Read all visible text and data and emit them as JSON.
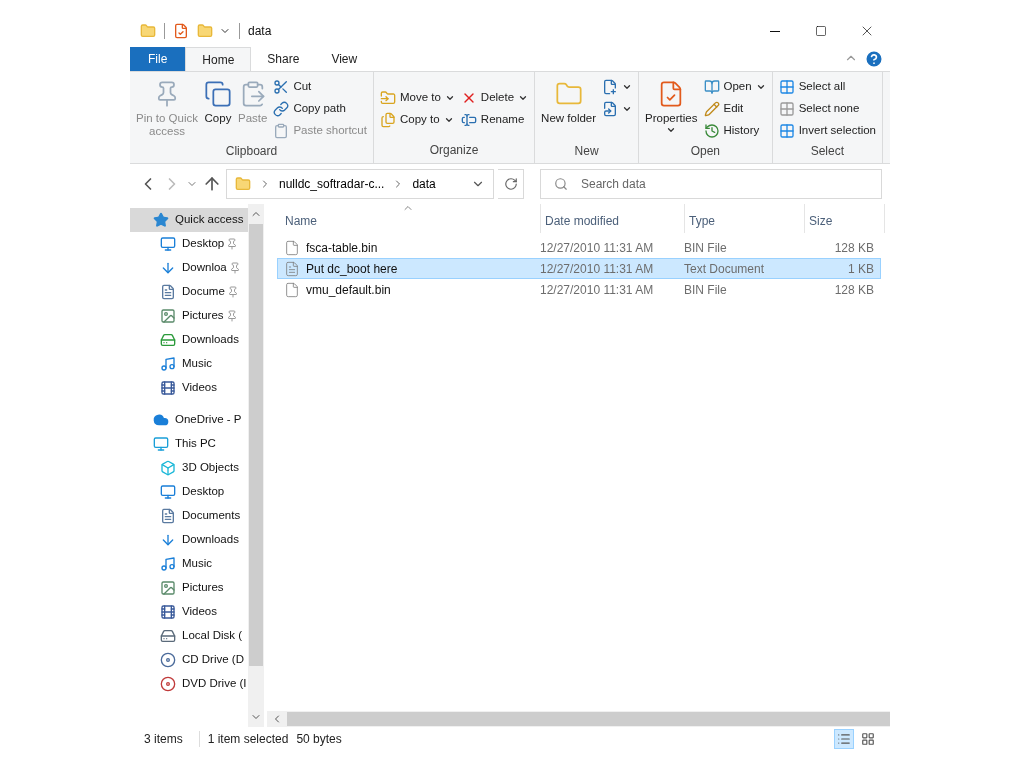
{
  "window": {
    "title": "data"
  },
  "tabs": [
    {
      "label": "File",
      "kind": "file",
      "selected": false
    },
    {
      "label": "Home",
      "kind": "tab",
      "selected": true
    },
    {
      "label": "Share",
      "kind": "tab",
      "selected": false
    },
    {
      "label": "View",
      "kind": "tab",
      "selected": false
    }
  ],
  "ribbon": [
    {
      "name": "Clipboard",
      "items": [
        {
          "kind": "pin",
          "label": "Pin to Quick access",
          "disabled": true,
          "dropdown": false
        },
        {
          "kind": "copy",
          "label": "Copy",
          "disabled": false,
          "dropdown": false
        },
        {
          "kind": "paste",
          "label": "Paste",
          "disabled": true,
          "dropdown": false
        },
        {
          "kind": "cut",
          "label": "Cut",
          "disabled": false,
          "dropdown": false
        },
        {
          "kind": "copypath",
          "label": "Copy path",
          "disabled": false,
          "dropdown": false
        },
        {
          "kind": "shortcut",
          "label": "Paste shortcut",
          "disabled": true,
          "dropdown": false
        }
      ]
    },
    {
      "name": "Organize",
      "items": [
        {
          "kind": "move",
          "label": "Move to",
          "disabled": false,
          "dropdown": true
        },
        {
          "kind": "copyto",
          "label": "Copy to",
          "disabled": false,
          "dropdown": true
        },
        {
          "kind": "delete",
          "label": "Delete",
          "disabled": false,
          "dropdown": true
        },
        {
          "kind": "rename",
          "label": "Rename",
          "disabled": false,
          "dropdown": false
        }
      ]
    },
    {
      "name": "New",
      "items": [
        {
          "kind": "folder",
          "label": "New folder",
          "disabled": false,
          "dropdown": false
        },
        {
          "kind": "newitem",
          "disabled": false,
          "dropdown": true
        },
        {
          "kind": "easyaccess",
          "disabled": false,
          "dropdown": true
        }
      ]
    },
    {
      "name": "Open",
      "items": [
        {
          "kind": "properties",
          "label": "Properties",
          "disabled": false,
          "dropdown": true
        },
        {
          "kind": "open",
          "label": "Open",
          "disabled": false,
          "dropdown": true
        },
        {
          "kind": "edit",
          "label": "Edit",
          "disabled": false,
          "dropdown": false
        },
        {
          "kind": "history",
          "label": "History",
          "disabled": false,
          "dropdown": false
        }
      ]
    },
    {
      "name": "Select",
      "items": [
        {
          "kind": "selectall",
          "label": "Select all",
          "disabled": false,
          "dropdown": false
        },
        {
          "kind": "selectnone",
          "label": "Select none",
          "disabled": false,
          "dropdown": false
        },
        {
          "kind": "invert",
          "label": "Invert selection",
          "disabled": false,
          "dropdown": false
        }
      ]
    }
  ],
  "address": {
    "path": [
      "nulldc_softradar-c...",
      "data"
    ]
  },
  "search": {
    "placeholder": "Search data"
  },
  "sidebar": {
    "items": [
      {
        "kind": "quick",
        "label": "Quick access",
        "selected": true,
        "pinned": false,
        "children": [
          {
            "kind": "desktop",
            "label": "Desktop",
            "selected": false,
            "pinned": true
          },
          {
            "kind": "downloads",
            "label": "Downloa",
            "selected": false,
            "pinned": true
          },
          {
            "kind": "documents",
            "label": "Docume",
            "selected": false,
            "pinned": true
          },
          {
            "kind": "pictures",
            "label": "Pictures",
            "selected": false,
            "pinned": true
          },
          {
            "kind": "network",
            "label": "Downloads",
            "selected": false,
            "pinned": false
          },
          {
            "kind": "music",
            "label": "Music",
            "selected": false,
            "pinned": false
          },
          {
            "kind": "videos",
            "label": "Videos",
            "selected": false,
            "pinned": false
          }
        ]
      },
      {
        "kind": "onedrive",
        "label": "OneDrive - P",
        "selected": false,
        "pinned": false
      },
      {
        "kind": "pc",
        "label": "This PC",
        "selected": false,
        "pinned": false,
        "children": [
          {
            "kind": "objects",
            "label": "3D Objects",
            "selected": false,
            "pinned": false
          },
          {
            "kind": "desktop",
            "label": "Desktop",
            "selected": false,
            "pinned": false
          },
          {
            "kind": "documents",
            "label": "Documents",
            "selected": false,
            "pinned": false
          },
          {
            "kind": "downloads",
            "label": "Downloads",
            "selected": false,
            "pinned": false
          },
          {
            "kind": "music",
            "label": "Music",
            "selected": false,
            "pinned": false
          },
          {
            "kind": "pictures",
            "label": "Pictures",
            "selected": false,
            "pinned": false
          },
          {
            "kind": "videos",
            "label": "Videos",
            "selected": false,
            "pinned": false
          },
          {
            "kind": "disk",
            "label": "Local Disk (",
            "selected": false,
            "pinned": false
          },
          {
            "kind": "cd",
            "label": "CD Drive (D",
            "selected": false,
            "pinned": false
          },
          {
            "kind": "dvd",
            "label": "DVD Drive (I",
            "selected": false,
            "pinned": false
          }
        ]
      }
    ]
  },
  "table": {
    "columns": [
      "Name",
      "Date modified",
      "Type",
      "Size"
    ],
    "rows": [
      {
        "kind": "file",
        "cells": [
          "fsca-table.bin",
          "12/27/2010 11:31 AM",
          "BIN File",
          "128 KB"
        ],
        "selected": false
      },
      {
        "kind": "text",
        "cells": [
          "Put dc_boot here",
          "12/27/2010 11:31 AM",
          "Text Document",
          "1 KB"
        ],
        "selected": true
      },
      {
        "kind": "file",
        "cells": [
          "vmu_default.bin",
          "12/27/2010 11:31 AM",
          "BIN File",
          "128 KB"
        ],
        "selected": false
      }
    ]
  },
  "status_bar": {
    "items": [
      "3 items",
      "1 item selected",
      "50 bytes"
    ],
    "views": [
      {
        "kind": "details",
        "selected": true
      },
      {
        "kind": "tiles",
        "selected": false
      }
    ]
  }
}
